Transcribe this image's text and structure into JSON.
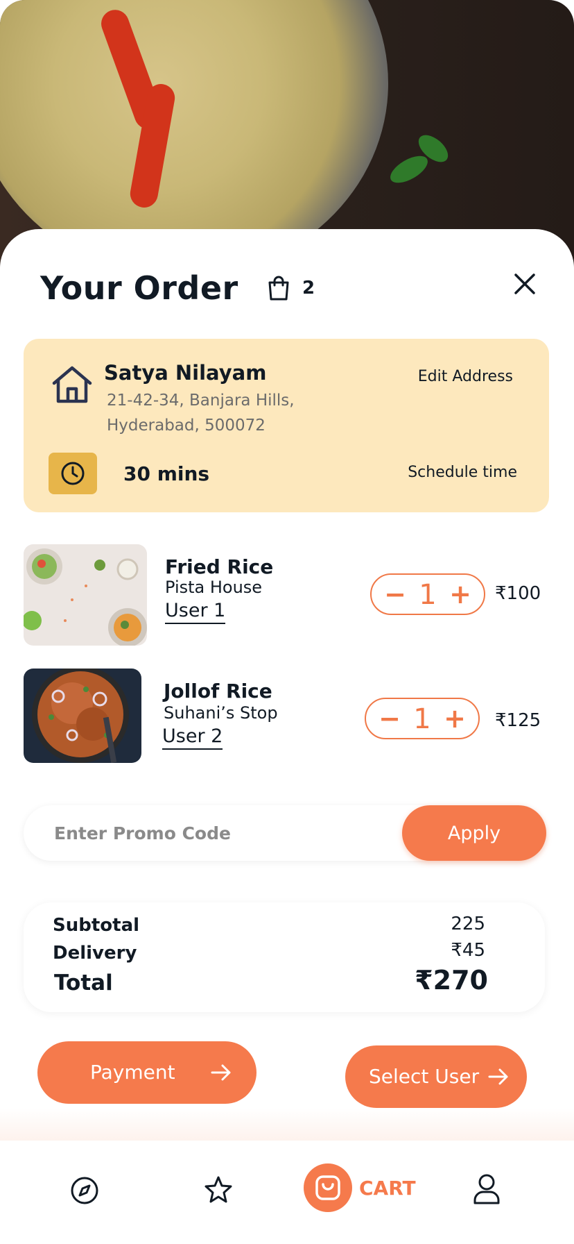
{
  "order": {
    "title": "Your Order",
    "cart_count": "2",
    "close_icon": "close-icon",
    "bag_icon": "shopping-bag-icon"
  },
  "address": {
    "name": "Satya Nilayam",
    "line1": "21-42-34, Banjara Hills,",
    "line2": "Hyderabad, 500072",
    "edit_label": "Edit Address",
    "eta": "30 mins",
    "schedule_label": "Schedule time"
  },
  "items": [
    {
      "name": "Fried Rice",
      "restaurant": "Pista House",
      "user": "User 1",
      "qty": "1",
      "minus": "−",
      "plus": "+",
      "price": "₹100"
    },
    {
      "name": "Jollof Rice",
      "restaurant": "Suhani’s Stop",
      "user": "User 2",
      "qty": "1",
      "minus": "−",
      "plus": "+",
      "price": "₹125"
    }
  ],
  "promo": {
    "placeholder": "Enter Promo Code",
    "apply_label": "Apply"
  },
  "summary": {
    "subtotal_label": "Subtotal",
    "subtotal_value": "225",
    "delivery_label": "Delivery",
    "delivery_value": "₹45",
    "total_label": "Total",
    "total_value": "₹270"
  },
  "actions": {
    "payment_label": "Payment",
    "select_user_label": "Select User"
  },
  "nav": {
    "cart_label": "CART",
    "items": [
      "compass-icon",
      "star-icon",
      "cart-icon",
      "user-icon"
    ]
  },
  "colors": {
    "accent": "#f57a4c",
    "address_card": "#fde8bd",
    "clock_box": "#e7b54a",
    "text": "#111a24"
  }
}
